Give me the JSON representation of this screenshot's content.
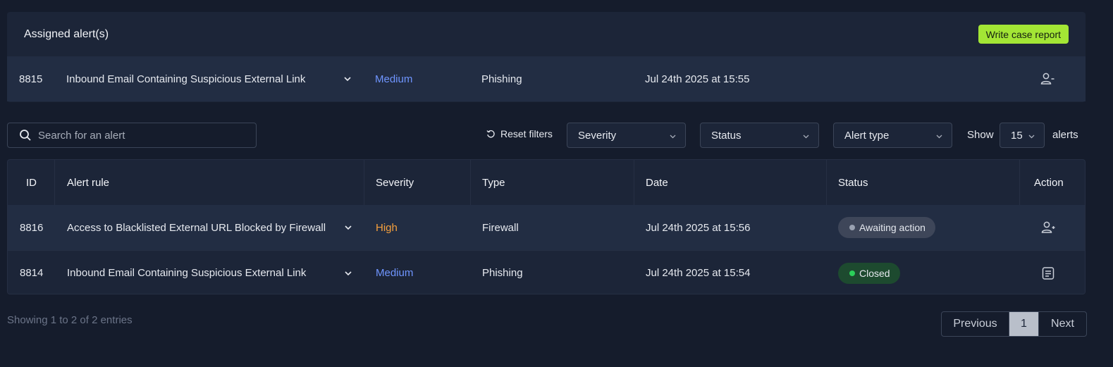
{
  "assigned": {
    "title": "Assigned alert(s)",
    "report_button": "Write case report",
    "row": {
      "id": "8815",
      "rule": "Inbound Email Containing Suspicious External Link",
      "severity": "Medium",
      "type": "Phishing",
      "date": "Jul 24th 2025 at 15:55",
      "action_icon": "unassign-user-icon"
    }
  },
  "toolbar": {
    "search_placeholder": "Search for an alert",
    "reset_label": "Reset filters",
    "severity_select": "Severity",
    "status_select": "Status",
    "alert_type_select": "Alert type",
    "show_label": "Show",
    "show_value": "15",
    "alerts_label": "alerts"
  },
  "table": {
    "headers": {
      "id": "ID",
      "rule": "Alert rule",
      "severity": "Severity",
      "type": "Type",
      "date": "Date",
      "status": "Status",
      "action": "Action"
    },
    "rows": [
      {
        "id": "8816",
        "rule": "Access to Blacklisted External URL Blocked by Firewall",
        "severity": "High",
        "type": "Firewall",
        "date": "Jul 24th 2025 at 15:56",
        "status": "Awaiting action",
        "action_icon": "assign-user-icon"
      },
      {
        "id": "8814",
        "rule": "Inbound Email Containing Suspicious External Link",
        "severity": "Medium",
        "type": "Phishing",
        "date": "Jul 24th 2025 at 15:54",
        "status": "Closed",
        "action_icon": "report-icon"
      }
    ]
  },
  "footer": {
    "info": "Showing 1 to 2 of 2 entries",
    "previous": "Previous",
    "page": "1",
    "next": "Next"
  },
  "colors": {
    "background": "#151c2c",
    "accent_button": "#a3e635",
    "severity_medium": "#6f95ff",
    "severity_high": "#f6a03d",
    "status_closed_dot": "#2bd05a"
  }
}
